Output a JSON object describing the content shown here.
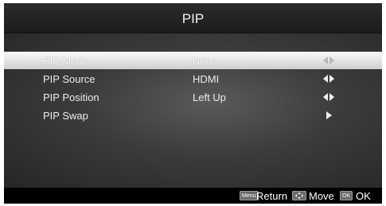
{
  "header": {
    "title": "PIP"
  },
  "menu": {
    "items": [
      {
        "label": "PIP Mode",
        "value": "None",
        "arrow_icon": "left-right-arrows-icon",
        "selected": true
      },
      {
        "label": "PIP Source",
        "value": "HDMI",
        "arrow_icon": "left-right-arrows-icon",
        "selected": false
      },
      {
        "label": "PIP Position",
        "value": "Left Up",
        "arrow_icon": "left-right-arrows-icon",
        "selected": false
      },
      {
        "label": "PIP Swap",
        "value": "",
        "arrow_icon": "right-arrow-icon",
        "selected": false
      }
    ]
  },
  "footer": {
    "menu_key": "Menu",
    "return_label": "Return",
    "move_key_icon": "dpad-icon",
    "move_label": "Move",
    "ok_key": "OK",
    "ok_label": "OK"
  }
}
